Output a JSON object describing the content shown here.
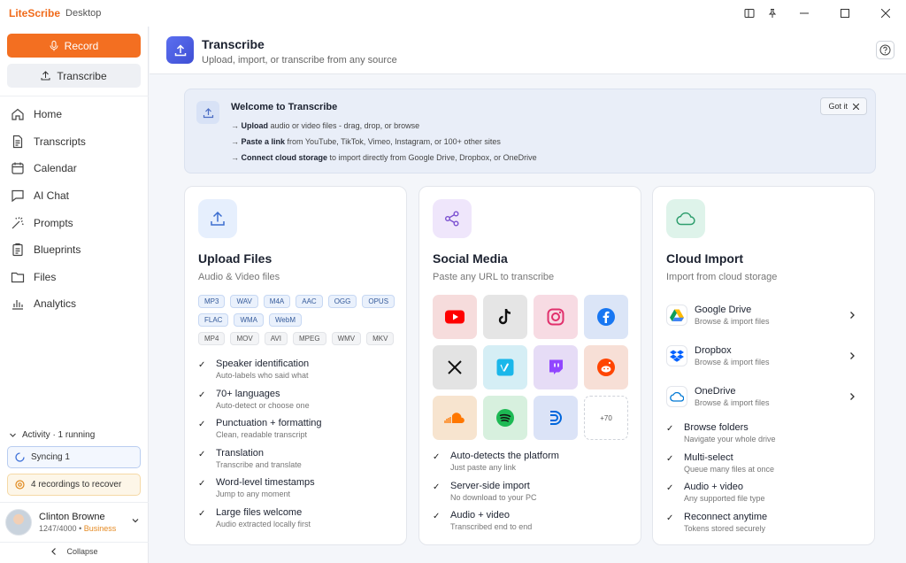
{
  "titlebar": {
    "app": "LiteScribe",
    "mode": "Desktop"
  },
  "sidebar": {
    "record_label": "Record",
    "transcribe_label": "Transcribe",
    "nav": [
      {
        "label": "Home",
        "icon": "home-icon"
      },
      {
        "label": "Transcripts",
        "icon": "document-icon"
      },
      {
        "label": "Calendar",
        "icon": "calendar-icon"
      },
      {
        "label": "AI Chat",
        "icon": "chat-icon"
      },
      {
        "label": "Prompts",
        "icon": "wand-icon"
      },
      {
        "label": "Blueprints",
        "icon": "clipboard-icon"
      },
      {
        "label": "Files",
        "icon": "folder-icon"
      },
      {
        "label": "Analytics",
        "icon": "bar-chart-icon"
      }
    ],
    "activity": "Activity · 1 running",
    "syncing": "Syncing 1",
    "recover": "4 recordings to recover",
    "user": {
      "name": "Clinton Browne",
      "usage": "1247/4000",
      "plan": "Business"
    },
    "collapse": "Collapse"
  },
  "header": {
    "title": "Transcribe",
    "subtitle": "Upload, import, or transcribe from any source"
  },
  "welcome": {
    "title": "Welcome to Transcribe",
    "got_it": "Got it",
    "lines": [
      {
        "bold": "Upload",
        "rest": " audio or video files - drag, drop, or browse"
      },
      {
        "bold": "Paste a link",
        "rest": " from YouTube, TikTok, Vimeo, Instagram, or 100+ other sites"
      },
      {
        "bold": "Connect cloud storage",
        "rest": " to import directly from Google Drive, Dropbox, or OneDrive"
      }
    ]
  },
  "upload": {
    "title": "Upload Files",
    "subtitle": "Audio & Video files",
    "audio_formats": [
      "MP3",
      "WAV",
      "M4A",
      "AAC",
      "OGG",
      "OPUS",
      "FLAC",
      "WMA",
      "WebM"
    ],
    "video_formats": [
      "MP4",
      "MOV",
      "AVI",
      "MPEG",
      "WMV",
      "MKV"
    ],
    "features": [
      {
        "title": "Speaker identification",
        "sub": "Auto-labels who said what"
      },
      {
        "title": "70+ languages",
        "sub": "Auto-detect or choose one"
      },
      {
        "title": "Punctuation + formatting",
        "sub": "Clean, readable transcript"
      },
      {
        "title": "Translation",
        "sub": "Transcribe and translate"
      },
      {
        "title": "Word-level timestamps",
        "sub": "Jump to any moment"
      },
      {
        "title": "Large files welcome",
        "sub": "Audio extracted locally first"
      }
    ]
  },
  "social": {
    "title": "Social Media",
    "subtitle": "Paste any URL to transcribe",
    "more_label": "+70",
    "features": [
      {
        "title": "Auto-detects the platform",
        "sub": "Just paste any link"
      },
      {
        "title": "Server-side import",
        "sub": "No download to your PC"
      },
      {
        "title": "Audio + video",
        "sub": "Transcribed end to end"
      }
    ]
  },
  "cloud": {
    "title": "Cloud Import",
    "subtitle": "Import from cloud storage",
    "providers": [
      {
        "name": "Google Drive",
        "desc": "Browse & import files"
      },
      {
        "name": "Dropbox",
        "desc": "Browse & import files"
      },
      {
        "name": "OneDrive",
        "desc": "Browse & import files"
      }
    ],
    "features": [
      {
        "title": "Browse folders",
        "sub": "Navigate your whole drive"
      },
      {
        "title": "Multi-select",
        "sub": "Queue many files at once"
      },
      {
        "title": "Audio + video",
        "sub": "Any supported file type"
      },
      {
        "title": "Reconnect anytime",
        "sub": "Tokens stored securely"
      }
    ]
  },
  "colors": {
    "accent": "#f36f21",
    "primary": "#4a5ce6",
    "brand": "#f06a1a"
  }
}
